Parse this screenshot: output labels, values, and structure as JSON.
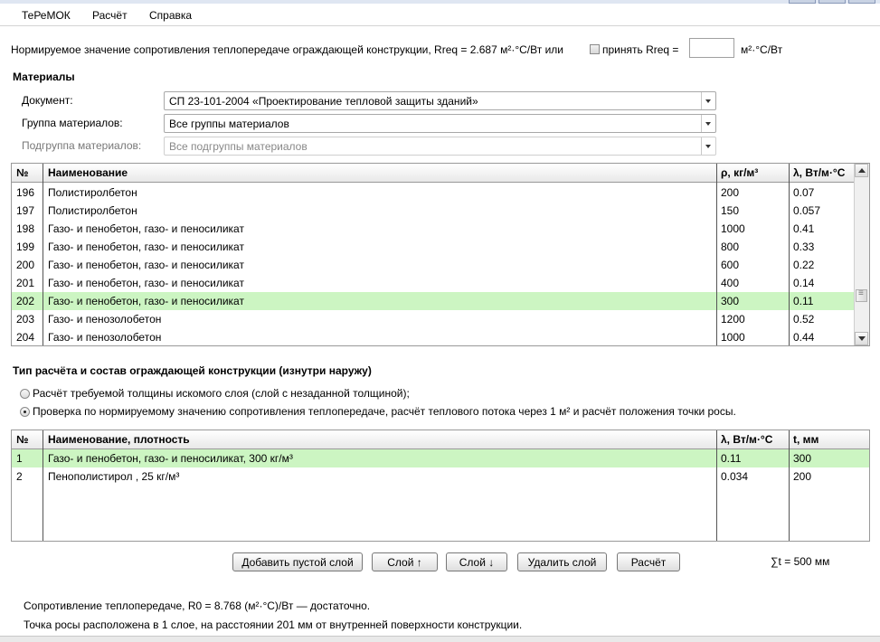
{
  "menu": [
    "ТеРеМОК",
    "Расчёт",
    "Справка"
  ],
  "requirement": {
    "text": "Нормируемое значение сопротивления теплопередаче ограждающей конструкции, Rreq = 2.687 м²·°С/Вт или",
    "accept_label": "принять Rreq =",
    "input_value": "",
    "unit": "м²·°С/Вт"
  },
  "materials": {
    "title": "Материалы",
    "document_label": "Документ:",
    "document_value": "СП 23-101-2004 «Проектирование тепловой защиты зданий»",
    "group_label": "Группа материалов:",
    "group_value": "Все группы материалов",
    "subgroup_label": "Подгруппа материалов:",
    "subgroup_value": "Все подгруппы материалов"
  },
  "materials_table": {
    "headers": [
      "№",
      "Наименование",
      "ρ, кг/м³",
      "λ, Вт/м·°С"
    ],
    "rows": [
      {
        "n": "196",
        "name": "Полистиролбетон",
        "rho": "200",
        "lambda": "0.07"
      },
      {
        "n": "197",
        "name": "Полистиролбетон",
        "rho": "150",
        "lambda": "0.057"
      },
      {
        "n": "198",
        "name": "Газо- и пенобетон, газо- и пеносиликат",
        "rho": "1000",
        "lambda": "0.41"
      },
      {
        "n": "199",
        "name": "Газо- и пенобетон, газо- и пеносиликат",
        "rho": "800",
        "lambda": "0.33"
      },
      {
        "n": "200",
        "name": "Газо- и пенобетон, газо- и пеносиликат",
        "rho": "600",
        "lambda": "0.22"
      },
      {
        "n": "201",
        "name": "Газо- и пенобетон, газо- и пеносиликат",
        "rho": "400",
        "lambda": "0.14"
      },
      {
        "n": "202",
        "name": "Газо- и пенобетон, газо- и пеносиликат",
        "rho": "300",
        "lambda": "0.11"
      },
      {
        "n": "203",
        "name": "Газо- и пенозолобетон",
        "rho": "1200",
        "lambda": "0.52"
      },
      {
        "n": "204",
        "name": "Газо- и пенозолобетон",
        "rho": "1000",
        "lambda": "0.44"
      }
    ]
  },
  "calc": {
    "title": "Тип расчёта и состав ограждающей конструкции (изнутри наружу)",
    "option1": "Расчёт требуемой толщины искомого слоя (слой с незаданной толщиной);",
    "option2": "Проверка по нормируемому значению сопротивления теплопередаче, расчёт теплового потока через 1 м² и расчёт положения точки росы."
  },
  "layers_table": {
    "headers": [
      "№",
      "Наименование, плотность",
      "λ, Вт/м·°С",
      "t, мм"
    ],
    "rows": [
      {
        "n": "1",
        "name": "Газо- и пенобетон, газо- и пеносиликат, 300 кг/м³",
        "lambda": "0.11",
        "t": "300"
      },
      {
        "n": "2",
        "name": "Пенополистирол , 25 кг/м³",
        "lambda": "0.034",
        "t": "200"
      }
    ]
  },
  "buttons": {
    "add": "Добавить пустой слой",
    "up": "Слой ↑",
    "down": "Слой ↓",
    "delete": "Удалить слой",
    "calc": "Расчёт"
  },
  "sum": "∑t = 500 мм",
  "results": {
    "line1": "Сопротивление теплопередаче, R0 = 8.768 (м²·°С)/Вт — достаточно.",
    "line2": "Точка росы расположена в 1 слое, на расстоянии 201 мм от внутренней поверхности конструкции."
  },
  "colors": {
    "selected_row": "#ccf5c2"
  }
}
